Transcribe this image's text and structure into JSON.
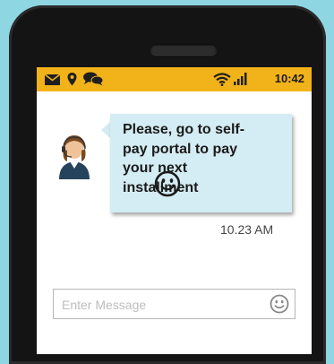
{
  "status_bar": {
    "time": "10:42",
    "icons": [
      "mail-icon",
      "location-pin-icon",
      "chat-icon",
      "wifi-icon",
      "signal-icon"
    ],
    "background_color": "#f2b31a"
  },
  "chat": {
    "agent_avatar": "support-agent-avatar",
    "message_lines": [
      "Please, go to self-",
      "pay portal to pay",
      "your next",
      "installment"
    ],
    "message_emoji": "smiley-icon",
    "timestamp": "10.23 AM",
    "bubble_color": "#d4ecf3"
  },
  "composer": {
    "placeholder": "Enter Message",
    "emoji_button": "smiley-icon"
  },
  "colors": {
    "background": "#8fd6e3",
    "phone_body": "#141414"
  }
}
